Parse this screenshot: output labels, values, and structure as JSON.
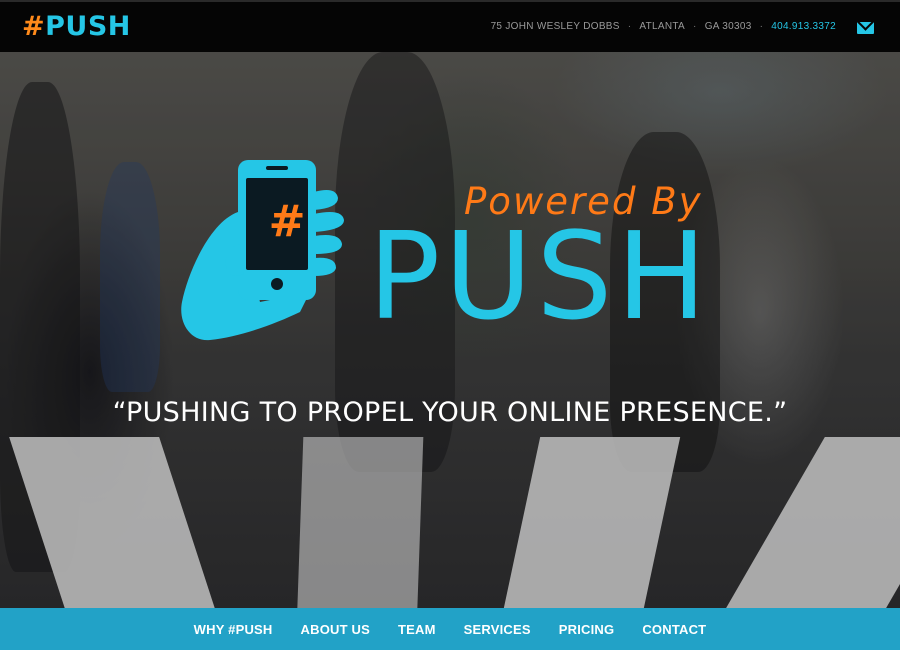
{
  "header": {
    "logo_hash": "#",
    "logo_text": "PUSH",
    "address_street": "75 JOHN WESLEY DOBBS",
    "separator": "·",
    "address_city": "ATLANTA",
    "address_zip": "GA 30303",
    "phone": "404.913.3372",
    "mail_icon": "envelope-icon"
  },
  "hero": {
    "powered_by": "Powered By",
    "brand_word": "PUSH",
    "tagline": "“PUSHING TO PROPEL YOUR ONLINE PRESENCE.”",
    "phone_icon": "hand-holding-phone-icon",
    "phone_hash": "#"
  },
  "nav": {
    "items": [
      "WHY #PUSH",
      "ABOUT US",
      "TEAM",
      "SERVICES",
      "PRICING",
      "CONTACT"
    ]
  },
  "colors": {
    "accent": "#25c6e6",
    "hash_orange": "#ff8a1a",
    "nav_bar": "#22a2c7",
    "top_bar": "#050505"
  }
}
